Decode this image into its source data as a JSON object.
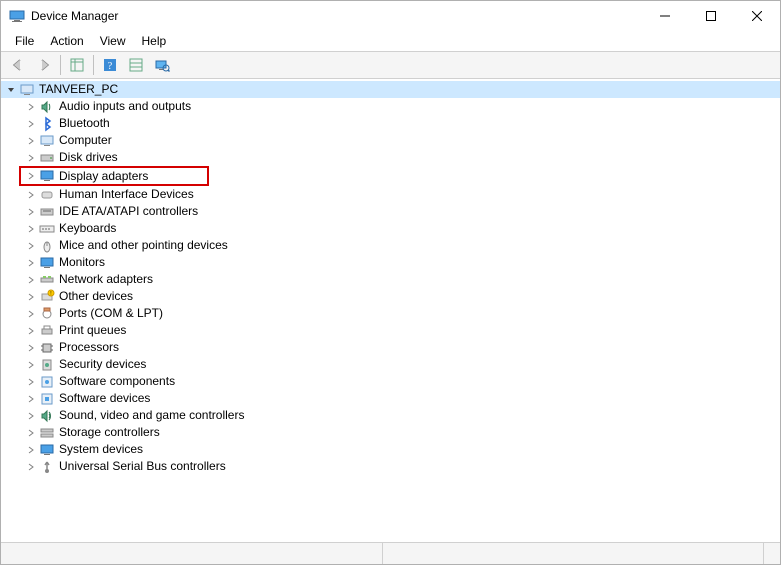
{
  "title": "Device Manager",
  "menus": {
    "file": "File",
    "action": "Action",
    "view": "View",
    "help": "Help"
  },
  "root": "TANVEER_PC",
  "categories": [
    "Audio inputs and outputs",
    "Bluetooth",
    "Computer",
    "Disk drives",
    "Display adapters",
    "Human Interface Devices",
    "IDE ATA/ATAPI controllers",
    "Keyboards",
    "Mice and other pointing devices",
    "Monitors",
    "Network adapters",
    "Other devices",
    "Ports (COM & LPT)",
    "Print queues",
    "Processors",
    "Security devices",
    "Software components",
    "Software devices",
    "Sound, video and game controllers",
    "Storage controllers",
    "System devices",
    "Universal Serial Bus controllers"
  ],
  "highlighted_index": 4
}
